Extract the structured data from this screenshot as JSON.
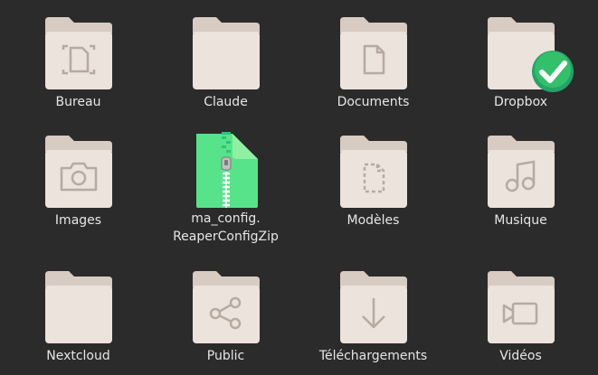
{
  "view": "file-grid",
  "colors": {
    "background": "#2b2b2b",
    "folder_tab": "#d7cbc2",
    "folder_body": "#ebe3dc",
    "folder_glyph": "#b7aaa1",
    "zip": "#57e389",
    "sync_ok": "#26a269"
  },
  "items": [
    {
      "label": "Bureau",
      "icon": "desktop-folder-icon"
    },
    {
      "label": "Claude",
      "icon": "folder-icon"
    },
    {
      "label": "Documents",
      "icon": "documents-folder-icon"
    },
    {
      "label": "Dropbox",
      "icon": "folder-icon",
      "emblem": "sync-check-emblem"
    },
    {
      "label": "Images",
      "icon": "pictures-folder-icon"
    },
    {
      "label_line1": "ma_config.",
      "label_line2": "ReaperConfigZip",
      "icon": "zip-archive-icon"
    },
    {
      "label": "Modèles",
      "icon": "templates-folder-icon"
    },
    {
      "label": "Musique",
      "icon": "music-folder-icon"
    },
    {
      "label": "Nextcloud",
      "icon": "folder-icon"
    },
    {
      "label": "Public",
      "icon": "public-share-folder-icon"
    },
    {
      "label": "Téléchargements",
      "icon": "downloads-folder-icon"
    },
    {
      "label": "Vidéos",
      "icon": "videos-folder-icon"
    }
  ]
}
